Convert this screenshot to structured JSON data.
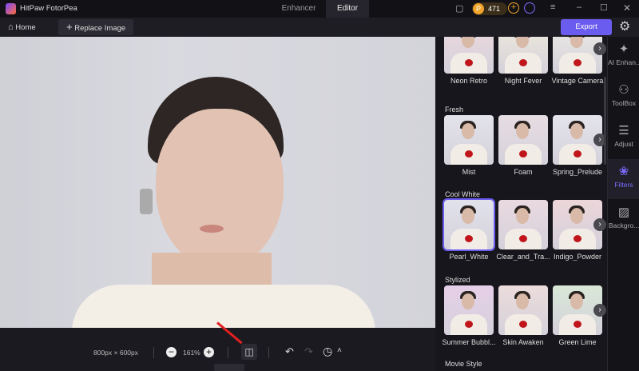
{
  "app": {
    "title": "HitPaw FotorPea",
    "tabs": [
      "Enhancer",
      "Editor"
    ],
    "active_tab": "Editor",
    "coins": "471"
  },
  "toolbar": {
    "home": "Home",
    "replace": "Replace Image",
    "export": "Export"
  },
  "bottom": {
    "dimensions": "800px × 600px",
    "zoom": "161%"
  },
  "panel": {
    "rows": [
      {
        "section": "",
        "items": [
          "Neon Retro",
          "Night Fever",
          "Vintage Camera"
        ],
        "tints": [
          "#ecd9de",
          "#efeadc",
          "#ecebe5"
        ]
      },
      {
        "section": "Fresh",
        "items": [
          "Mist",
          "Foam",
          "Spring_Prelude"
        ],
        "tints": [
          "#e3e3ea",
          "#e7dde3",
          "#e4e4ec"
        ]
      },
      {
        "section": "Cool White",
        "items": [
          "Pearl_White",
          "Clear_and_Tra...",
          "Indigo_Powder"
        ],
        "tints": [
          "#e1e2ec",
          "#ead9e0",
          "#ecd6da"
        ]
      },
      {
        "section": "Stylized",
        "items": [
          "Summer Bubbl...",
          "Skin Awaken",
          "Green Lime"
        ],
        "tints": [
          "#e6cfe9",
          "#ecdcdc",
          "#d8e8d8"
        ]
      }
    ],
    "next_section": "Movie Style"
  },
  "sidebar": [
    {
      "label": "AI Enhan...",
      "icon": "ai-enhance-icon",
      "glyph": "✦"
    },
    {
      "label": "ToolBox",
      "icon": "toolbox-icon",
      "glyph": "⚇"
    },
    {
      "label": "Adjust",
      "icon": "adjust-icon",
      "glyph": "☰"
    },
    {
      "label": "Filters",
      "icon": "filters-icon",
      "glyph": "❀"
    },
    {
      "label": "Backgro...",
      "icon": "background-icon",
      "glyph": "▨"
    }
  ],
  "colors": {
    "accent": "#6b5cf0"
  }
}
